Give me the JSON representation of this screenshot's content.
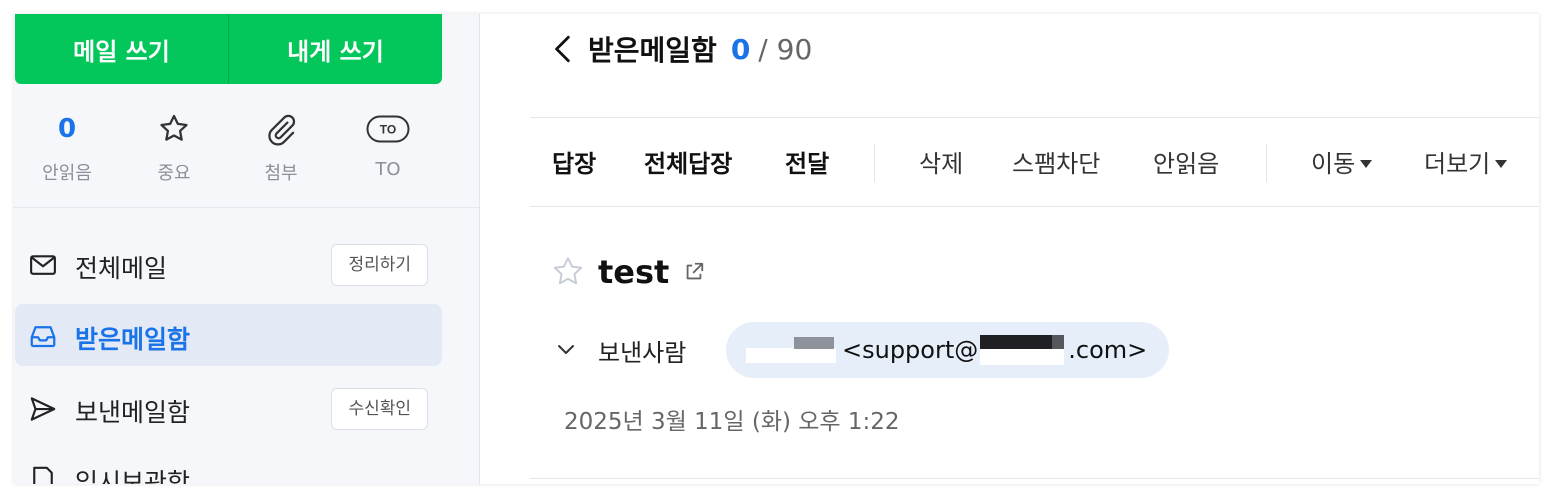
{
  "compose": {
    "write_mail": "메일 쓰기",
    "write_to_self": "내게 쓰기"
  },
  "quick_filters": [
    {
      "label": "안읽음",
      "count": "0"
    },
    {
      "label": "중요",
      "icon": "star-icon"
    },
    {
      "label": "첨부",
      "icon": "paperclip-icon"
    },
    {
      "label": "TO",
      "icon": "to-badge-icon",
      "badge": "TO"
    }
  ],
  "nav": {
    "items": [
      {
        "label": "전체메일",
        "icon": "envelope-icon",
        "action": "정리하기"
      },
      {
        "label": "받은메일함",
        "icon": "inbox-icon",
        "active": true
      },
      {
        "label": "보낸메일함",
        "icon": "paper-plane-icon",
        "action": "수신확인"
      },
      {
        "label": "임시보관함",
        "icon": "draft-icon"
      }
    ]
  },
  "header": {
    "folder": "받은메일함",
    "unread": "0",
    "total": "/ 90"
  },
  "toolbar": {
    "reply": "답장",
    "reply_all": "전체답장",
    "forward": "전달",
    "delete": "삭제",
    "block_spam": "스팸차단",
    "mark_unread": "안읽음",
    "move": "이동",
    "more": "더보기"
  },
  "message": {
    "subject": "test",
    "from_label": "보낸사람",
    "from_email_prefix": "<support@",
    "from_email_suffix": ".com>",
    "date": "2025년 3월 11일 (화) 오후 1:22"
  },
  "colors": {
    "brand_green": "#03c75a",
    "accent_blue": "#1a73e8",
    "active_nav_bg": "#e3eaf6",
    "sender_chip_bg": "#e6eefa"
  }
}
